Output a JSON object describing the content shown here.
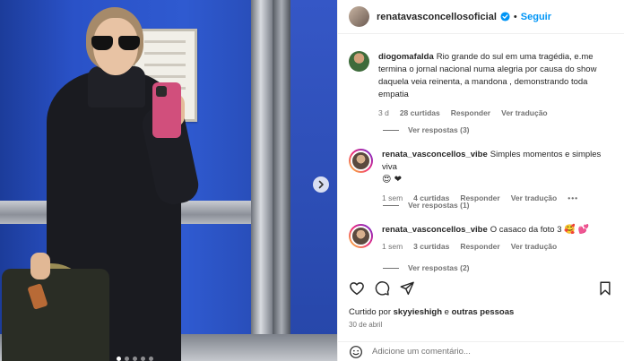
{
  "post": {
    "author": "renatavasconcellosoficial",
    "follow_label": "Seguir",
    "separator": "•",
    "likes_prefix": "Curtido por",
    "likes_user": "skyyieshigh",
    "likes_suffix": "e",
    "likes_others": "outras pessoas",
    "date": "30 de abril",
    "comment_placeholder": "Adicione um comentário..."
  },
  "comments": [
    {
      "user": "diogomafalda",
      "text": "Rio grande do sul em uma tragédia, e.me termina o jornal nacional numa alegria por causa do show daquela veia reinenta, a mandona , demonstrando toda empatia",
      "time": "3 d",
      "likes": "28 curtidas",
      "reply": "Responder",
      "translate": "Ver tradução",
      "view_replies": "Ver respostas (3)"
    },
    {
      "user": "renata_vasconcellos_vibe",
      "text": "Simples momentos e simples viva",
      "emoji": "😍 ❤",
      "time": "1 sem",
      "likes": "4 curtidas",
      "reply": "Responder",
      "translate": "Ver tradução",
      "more": "•••",
      "view_replies": "Ver respostas (1)"
    },
    {
      "user": "renata_vasconcellos_vibe",
      "text": "O casaco da foto 3",
      "emoji": "🥰 💕",
      "time": "1 sem",
      "likes": "3 curtidas",
      "reply": "Responder",
      "translate": "Ver tradução",
      "view_replies": "Ver respostas (2)"
    }
  ],
  "icons": {
    "verified": "verified-badge-icon",
    "like": "heart-icon",
    "comment": "comment-bubble-icon",
    "share": "paper-plane-icon",
    "save": "bookmark-icon",
    "emoji": "smiley-icon",
    "next": "chevron-right-icon"
  },
  "colors": {
    "accent": "#0095f6",
    "verified": "#0095f6",
    "muted": "#737373",
    "text": "#262626"
  }
}
